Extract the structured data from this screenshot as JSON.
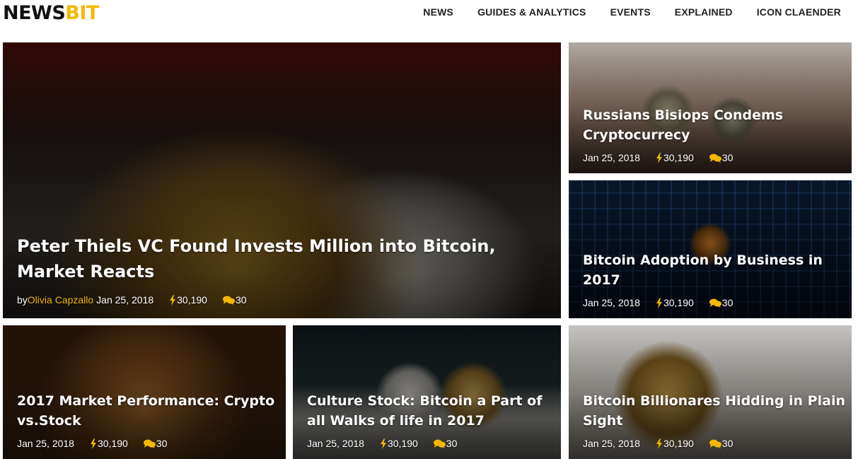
{
  "brand": {
    "logo_part1": "NEWS",
    "logo_part2": "BIT"
  },
  "nav": {
    "items": [
      {
        "label": "NEWS"
      },
      {
        "label": "GUIDES & ANALYTICS"
      },
      {
        "label": "EVENTS"
      },
      {
        "label": "EXPLAINED"
      },
      {
        "label": "ICON CLAENDER"
      }
    ]
  },
  "articles": [
    {
      "title": "Peter Thiels VC Found Invests Million into Bitcoin, Market Reacts",
      "author_prefix": "by",
      "author": "Olivia Capzallo",
      "date": "Jan 25, 2018",
      "views": "30,190",
      "comments": "30"
    },
    {
      "title": "Russians Bisiops Condems Cryptocurrecy",
      "date": "Jan 25, 2018",
      "views": "30,190",
      "comments": "30"
    },
    {
      "title": "Bitcoin Adoption by Business in 2017",
      "date": "Jan 25, 2018",
      "views": "30,190",
      "comments": "30"
    },
    {
      "title": "2017 Market Performance: Crypto vs.Stock",
      "date": "Jan 25, 2018",
      "views": "30,190",
      "comments": "30"
    },
    {
      "title": "Culture Stock: Bitcoin a Part of all Walks of life in 2017",
      "date": "Jan 25, 2018",
      "views": "30,190",
      "comments": "30"
    },
    {
      "title": "Bitcoin Billionares Hidding in Plain Sight",
      "date": "Jan 25, 2018",
      "views": "30,190",
      "comments": "30"
    }
  ],
  "icons": {
    "views": "bolt-icon",
    "comments": "chat-bubbles-icon"
  },
  "colors": {
    "accent": "#f5b800",
    "text_dark": "#222222"
  }
}
